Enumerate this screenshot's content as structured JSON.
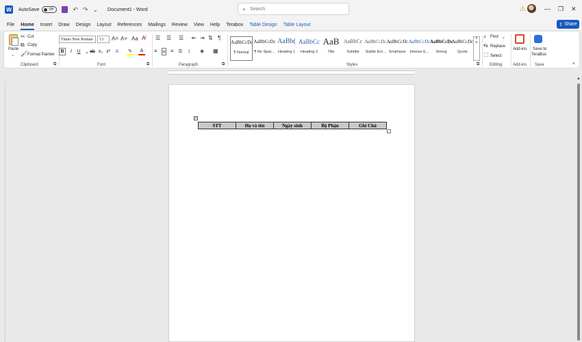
{
  "titlebar": {
    "app_logo": "W",
    "autosave_label": "AutoSave",
    "autosave_state": "Off",
    "doc_title": "Document1 - Word",
    "search_placeholder": "Search",
    "icons": [
      "save-icon",
      "undo-icon",
      "redo-icon",
      "customize-icon"
    ],
    "window_controls": [
      "—",
      "❐",
      "✕"
    ]
  },
  "menu": {
    "tabs": [
      "File",
      "Home",
      "Insert",
      "Draw",
      "Design",
      "Layout",
      "References",
      "Mailings",
      "Review",
      "View",
      "Help",
      "Terabox",
      "Table Design",
      "Table Layout"
    ],
    "active": "Home",
    "share_label": "Share"
  },
  "ribbon": {
    "clipboard": {
      "paste": "Paste",
      "cut": "Cut",
      "copy": "Copy",
      "format_painter": "Format Painter",
      "label": "Clipboard"
    },
    "font": {
      "font_name": "Times New Roman",
      "font_size": "13",
      "label": "Font"
    },
    "paragraph": {
      "label": "Paragraph"
    },
    "styles": {
      "label": "Styles",
      "items": [
        {
          "sample": "AaBbCcDc",
          "name": "¶ Normal"
        },
        {
          "sample": "AaBbCcDc",
          "name": "¶ No Spac..."
        },
        {
          "sample": "AaBb(",
          "name": "Heading 1"
        },
        {
          "sample": "AaBbCc",
          "name": "Heading 2"
        },
        {
          "sample": "AaB",
          "name": "Title"
        },
        {
          "sample": "AaBbCc",
          "name": "Subtitle"
        },
        {
          "sample": "AaBbCcDc",
          "name": "Subtle Em..."
        },
        {
          "sample": "AaBbCcDc",
          "name": "Emphasis"
        },
        {
          "sample": "AaBbCcDc",
          "name": "Intense E..."
        },
        {
          "sample": "AaBbCcDc",
          "name": "Strong"
        },
        {
          "sample": "AaBbCcDc",
          "name": "Quote"
        }
      ]
    },
    "editing": {
      "find": "Find",
      "replace": "Replace",
      "select": "Select",
      "label": "Editing"
    },
    "addins": {
      "button": "Add-ins",
      "label": "Add-ins"
    },
    "save": {
      "button_line1": "Save to",
      "button_line2": "TeraBox",
      "label": "Save"
    }
  },
  "document": {
    "table_headers": [
      "STT",
      "Họ và tên",
      "Ngày sinh",
      "Bộ Phận",
      "Ghi Chú"
    ]
  },
  "colors": {
    "accent": "#185abd",
    "table_fill": "#c8c8c8",
    "highlight": "#ffff00",
    "font_color": "#ff0000"
  }
}
